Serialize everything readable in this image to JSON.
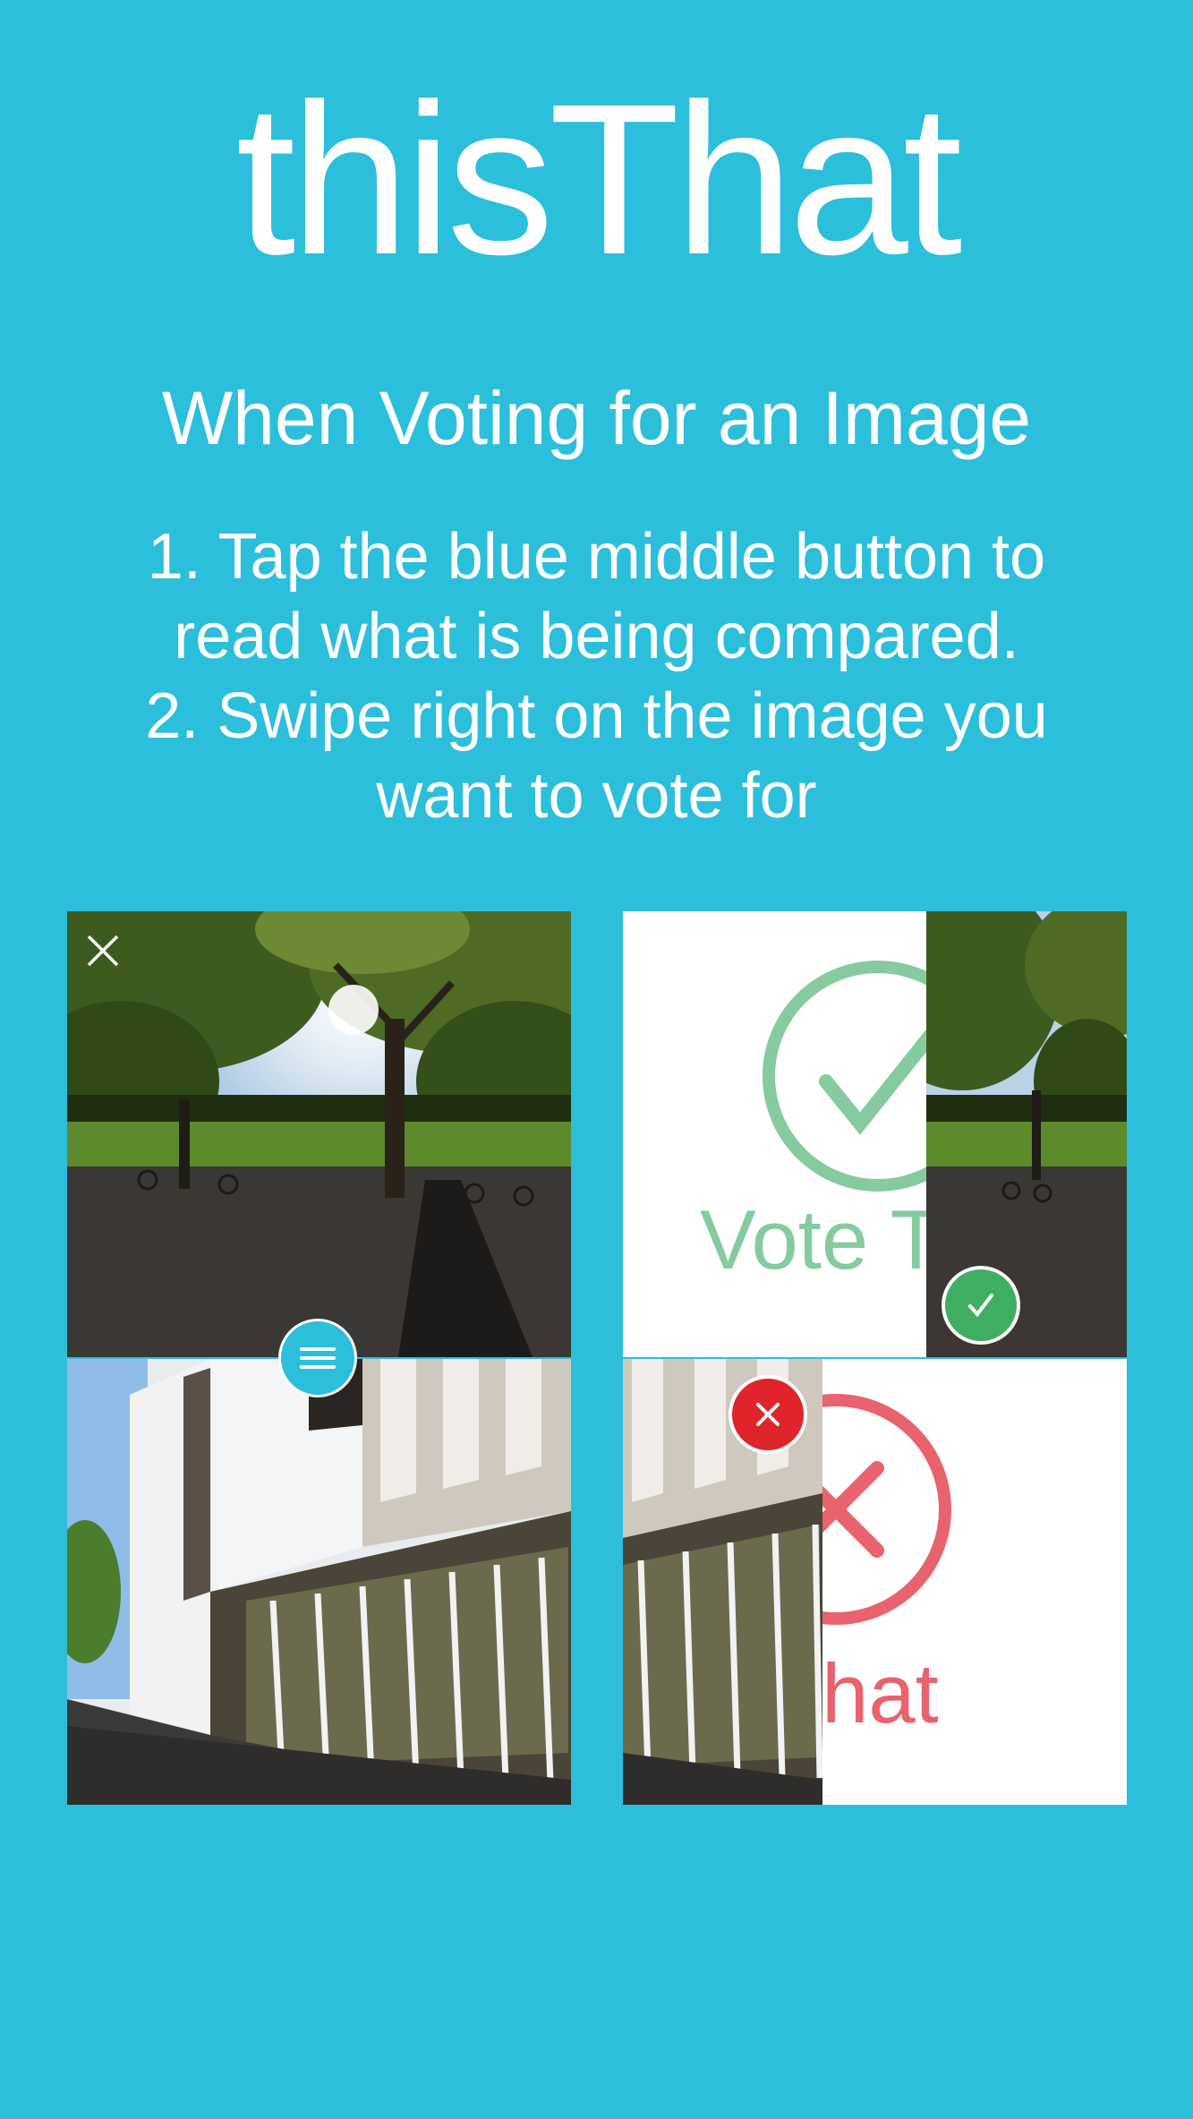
{
  "app": {
    "title": "thisThat"
  },
  "header": {
    "subtitle": "When Voting for an Image"
  },
  "instructions": {
    "lines": [
      "1. Tap the blue middle button to",
      "read what is being compared.",
      "2. Swipe right on the image you",
      "want to vote for"
    ]
  },
  "demo": {
    "vote_this_label": "Vote This",
    "not_that_label": "Not That",
    "icons": {
      "close": "close-icon",
      "menu": "menu-icon",
      "check": "check-icon",
      "x": "x-icon"
    },
    "colors": {
      "background": "#2bbfdb",
      "menu_button": "#2bbfdb",
      "vote_green": "#86cba0",
      "check_badge": "#3fae63",
      "not_red": "#e8636d",
      "x_badge": "#e0242b"
    }
  }
}
